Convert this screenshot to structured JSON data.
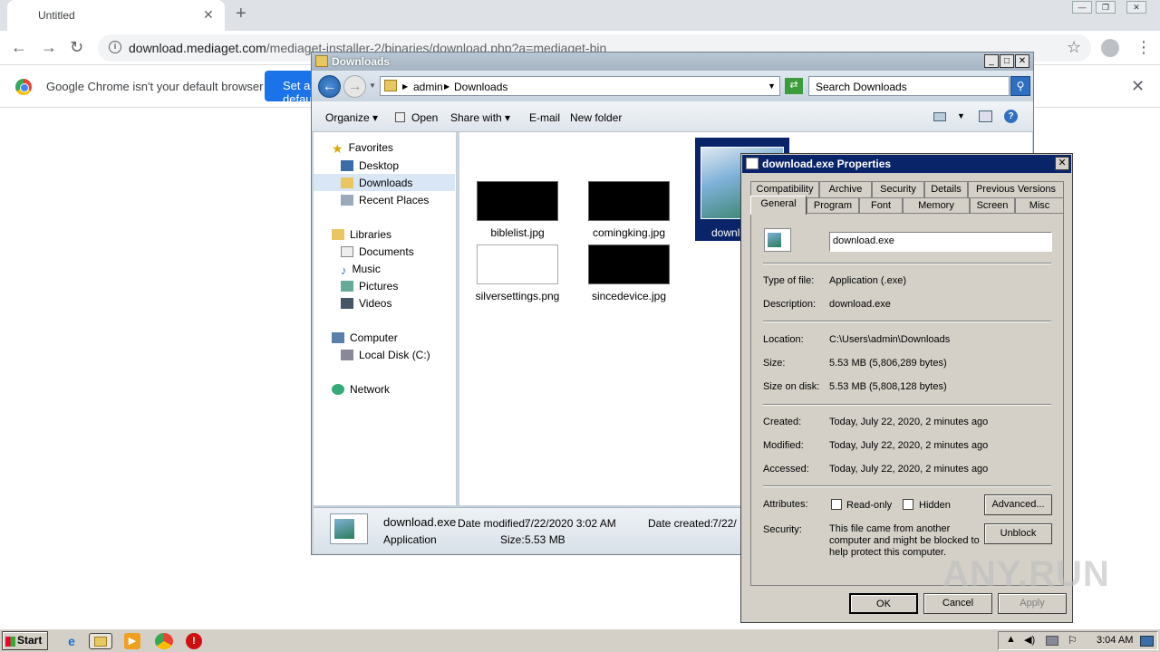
{
  "browser": {
    "tab_title": "Untitled",
    "url_host": "download.mediaget.com",
    "url_path": "/mediaget-installer-2/binaries/download.php?a=mediaget-bin",
    "infobar_text": "Google Chrome isn't your default browser",
    "set_default_label": "Set as default"
  },
  "explorer": {
    "title": "Downloads",
    "breadcrumb": [
      "admin",
      "Downloads"
    ],
    "search_placeholder": "Search Downloads",
    "commands": [
      "Organize",
      "Open",
      "Share with",
      "E-mail",
      "New folder"
    ],
    "nav": {
      "favorites": "Favorites",
      "desktop": "Desktop",
      "downloads": "Downloads",
      "recent": "Recent Places",
      "libraries": "Libraries",
      "documents": "Documents",
      "music": "Music",
      "pictures": "Pictures",
      "videos": "Videos",
      "computer": "Computer",
      "local_disk": "Local Disk (C:)",
      "network": "Network"
    },
    "files": [
      "biblelist.jpg",
      "comingking.jpg",
      "silversettings.png",
      "sincedevice.jpg"
    ],
    "selected_file_label": "downlo",
    "status": {
      "name": "download.exe",
      "type": "Application",
      "date_modified_label": "Date modified:",
      "date_modified": "7/22/2020 3:02 AM",
      "size_label": "Size:",
      "size": "5.53 MB",
      "date_created_label": "Date created:",
      "date_created": "7/22/"
    }
  },
  "properties": {
    "title": "download.exe Properties",
    "tabs_row1": [
      "Compatibility",
      "Archive",
      "Security",
      "Details",
      "Previous Versions"
    ],
    "tabs_row2": [
      "General",
      "Program",
      "Font",
      "Memory",
      "Screen",
      "Misc"
    ],
    "filename": "download.exe",
    "type_label": "Type of file:",
    "type_value": "Application (.exe)",
    "desc_label": "Description:",
    "desc_value": "download.exe",
    "location_label": "Location:",
    "location_value": "C:\\Users\\admin\\Downloads",
    "size_label": "Size:",
    "size_value": "5.53 MB (5,806,289 bytes)",
    "disk_label": "Size on disk:",
    "disk_value": "5.53 MB (5,808,128 bytes)",
    "created_label": "Created:",
    "created_value": "Today, July 22, 2020, 2 minutes ago",
    "modified_label": "Modified:",
    "modified_value": "Today, July 22, 2020, 2 minutes ago",
    "accessed_label": "Accessed:",
    "accessed_value": "Today, July 22, 2020, 2 minutes ago",
    "attributes_label": "Attributes:",
    "readonly_label": "Read-only",
    "hidden_label": "Hidden",
    "advanced_label": "Advanced...",
    "security_label": "Security:",
    "security_text": "This file came from another computer and might be blocked to help protect this computer.",
    "unblock_label": "Unblock",
    "ok_label": "OK",
    "cancel_label": "Cancel",
    "apply_label": "Apply"
  },
  "taskbar": {
    "start_label": "Start",
    "clock": "3:04 AM"
  },
  "watermark": "ANY.RUN"
}
